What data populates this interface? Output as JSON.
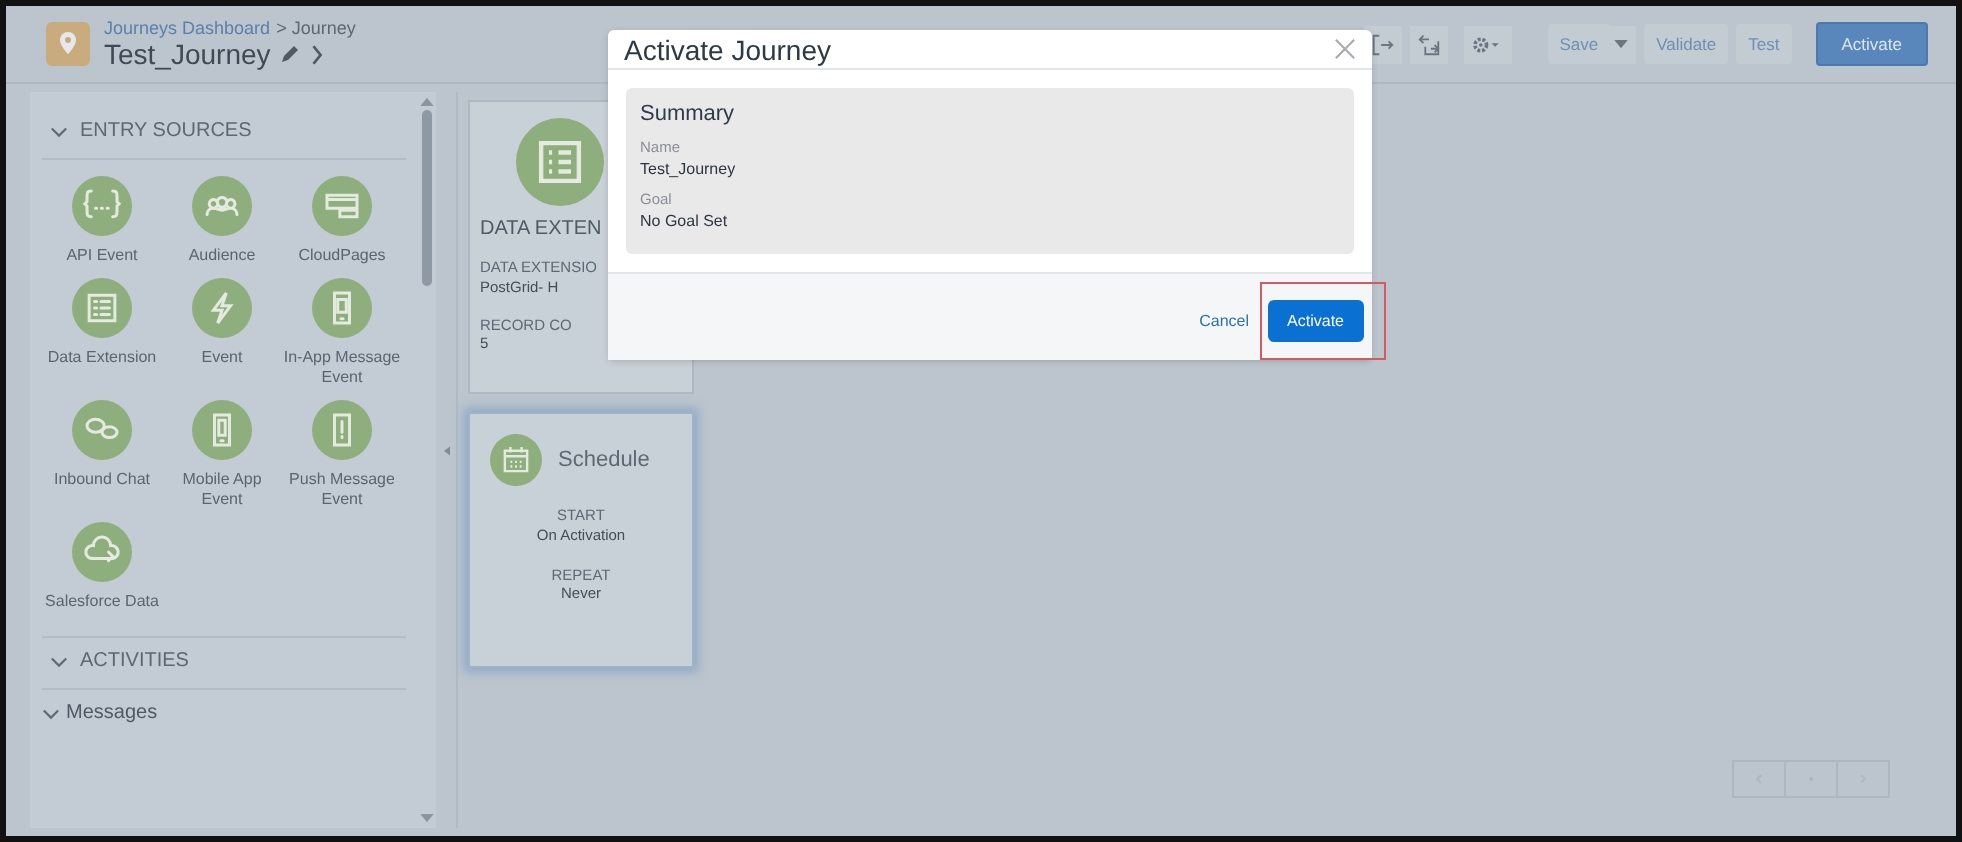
{
  "header": {
    "breadcrumb": [
      {
        "label": "Journeys Dashboard",
        "kind": "link"
      },
      {
        "label": "> Journey",
        "kind": "text"
      }
    ],
    "title": "Test_Journey"
  },
  "toolbar": {
    "buttons": [
      {
        "label": "Save",
        "kind": "plain"
      },
      {
        "label": "Validate",
        "kind": "plain"
      },
      {
        "label": "Test",
        "kind": "plain"
      },
      {
        "label": "Activate",
        "kind": "primary"
      }
    ]
  },
  "sidebar": {
    "sections": [
      {
        "label": "ENTRY SOURCES",
        "kind": "section",
        "items": [
          {
            "label": "API Event"
          },
          {
            "label": "Audience"
          },
          {
            "label": "CloudPages"
          },
          {
            "label": "Data Extension"
          },
          {
            "label": "Event"
          },
          {
            "label": "In-App Message Event"
          },
          {
            "label": "Inbound Chat"
          },
          {
            "label": "Mobile App Event"
          },
          {
            "label": "Push Message Event"
          },
          {
            "label": "Salesforce Data"
          }
        ]
      },
      {
        "label": "ACTIVITIES",
        "kind": "section"
      },
      {
        "label": "Messages",
        "kind": "subsection"
      }
    ]
  },
  "canvas": {
    "cards": [
      {
        "kind": "entry",
        "title": "DATA EXTEN",
        "selected": false,
        "fields": [
          {
            "label": "DATA EXTENSIO",
            "value": "PostGrid- H"
          },
          {
            "label": "RECORD CO",
            "value": "5"
          }
        ]
      },
      {
        "kind": "schedule",
        "title": "Schedule",
        "selected": true,
        "fields": [
          {
            "label": "START",
            "value": "On Activation"
          },
          {
            "label": "REPEAT",
            "value": "Never"
          }
        ]
      }
    ]
  },
  "modal": {
    "title": "Activate Journey",
    "summary": {
      "heading": "Summary",
      "fields": [
        {
          "label": "Name",
          "value": "Test_Journey"
        },
        {
          "label": "Goal",
          "value": "No Goal Set"
        }
      ]
    },
    "buttons": [
      {
        "label": "Cancel",
        "kind": "link",
        "highlighted": false
      },
      {
        "label": "Activate",
        "kind": "primary",
        "highlighted": true
      }
    ]
  }
}
